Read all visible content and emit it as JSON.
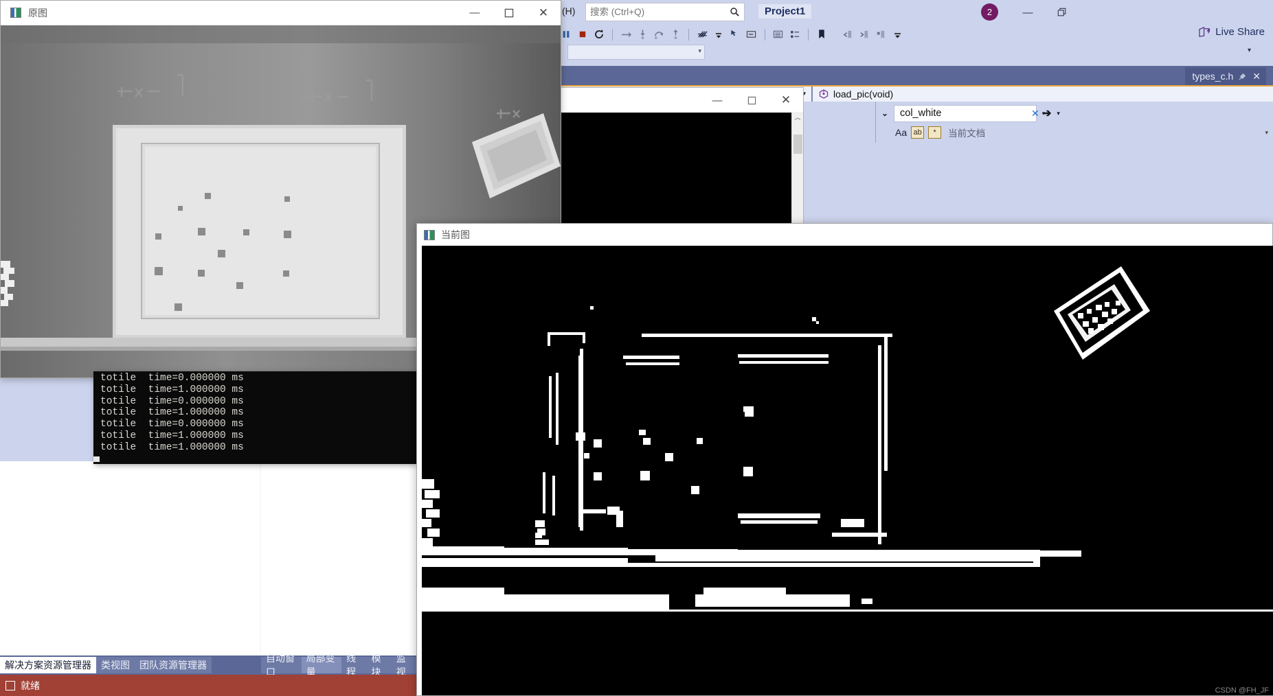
{
  "vs": {
    "menu_tail": "(H)",
    "search": {
      "placeholder": "搜索 (Ctrl+Q)",
      "value": "",
      "icon": "search-icon"
    },
    "project_name": "Project1",
    "notification_count": "2",
    "minimize": "—",
    "restore": "❐",
    "live_share": "Live Share",
    "toolbar_icons": [
      "pause-icon",
      "stop-icon",
      "restart-icon",
      "step-over-icon",
      "step-into-icon",
      "step-out-return-icon",
      "step-out-icon",
      "threads-icon",
      "overflow-icon",
      "show-next-statement-icon",
      "frames-icon",
      "breakpoints-icon",
      "bookmark-icon",
      "prev-bookmark-icon",
      "next-bookmark-icon",
      "clear-bookmark-icon",
      "overflow2-icon"
    ],
    "tab": {
      "label": "types_c.h",
      "pin": "pin-icon",
      "close": "✕"
    },
    "navbar": {
      "scope_left": "",
      "member": "load_pic(void)",
      "member_icon": "method-cube-icon"
    },
    "find": {
      "expand_icon": "chevron-down-icon",
      "value": "col_white",
      "clear": "✕",
      "history_caret": "▾",
      "find_next": "➔",
      "find_next_caret": "▾",
      "match_case_label": "Aa",
      "match_word_label": "ab",
      "regex_label": "*",
      "scope": "当前文档",
      "options_caret": "▾"
    }
  },
  "bottom_left_tabs": [
    {
      "label": "解决方案资源管理器",
      "state": "active"
    },
    {
      "label": "类视图",
      "state": "semi"
    },
    {
      "label": "团队资源管理器",
      "state": "semi"
    }
  ],
  "bottom_right_tabs": [
    {
      "label": "自动窗口",
      "state": "semi"
    },
    {
      "label": "局部变量",
      "state": "active-semi"
    },
    {
      "label": "线程",
      "state": "semi"
    },
    {
      "label": "模块",
      "state": "semi"
    },
    {
      "label": "监视",
      "state": "semi"
    }
  ],
  "statusbar": {
    "text": "就绪",
    "icon": "checkbox-icon"
  },
  "windows": {
    "yuantu": {
      "title": "原图",
      "icon": "image-window-icon",
      "minimize": "—",
      "maximize": "☐",
      "close": "✕"
    },
    "dangqian": {
      "title": "当前图",
      "icon": "image-window-icon"
    },
    "mid": {
      "title": "",
      "minimize": "—",
      "maximize": "☐",
      "close": "✕",
      "scroll_up": "︿"
    }
  },
  "console": {
    "lines": [
      "totile  time=0.000000 ms",
      "totile  time=1.000000 ms",
      "totile  time=0.000000 ms",
      "totile  time=1.000000 ms",
      "totile  time=0.000000 ms",
      "totile  time=1.000000 ms",
      "totile  time=1.000000 ms"
    ]
  },
  "watermark": "CSDN @FH_JF",
  "colors": {
    "vs_chrome": "#ccd3ec",
    "vs_tabstrip": "#5b6796",
    "accent_orange": "#e8a33d",
    "status_red": "#a14034",
    "badge_purple": "#721b62",
    "link_blue": "#1f6fd0"
  }
}
